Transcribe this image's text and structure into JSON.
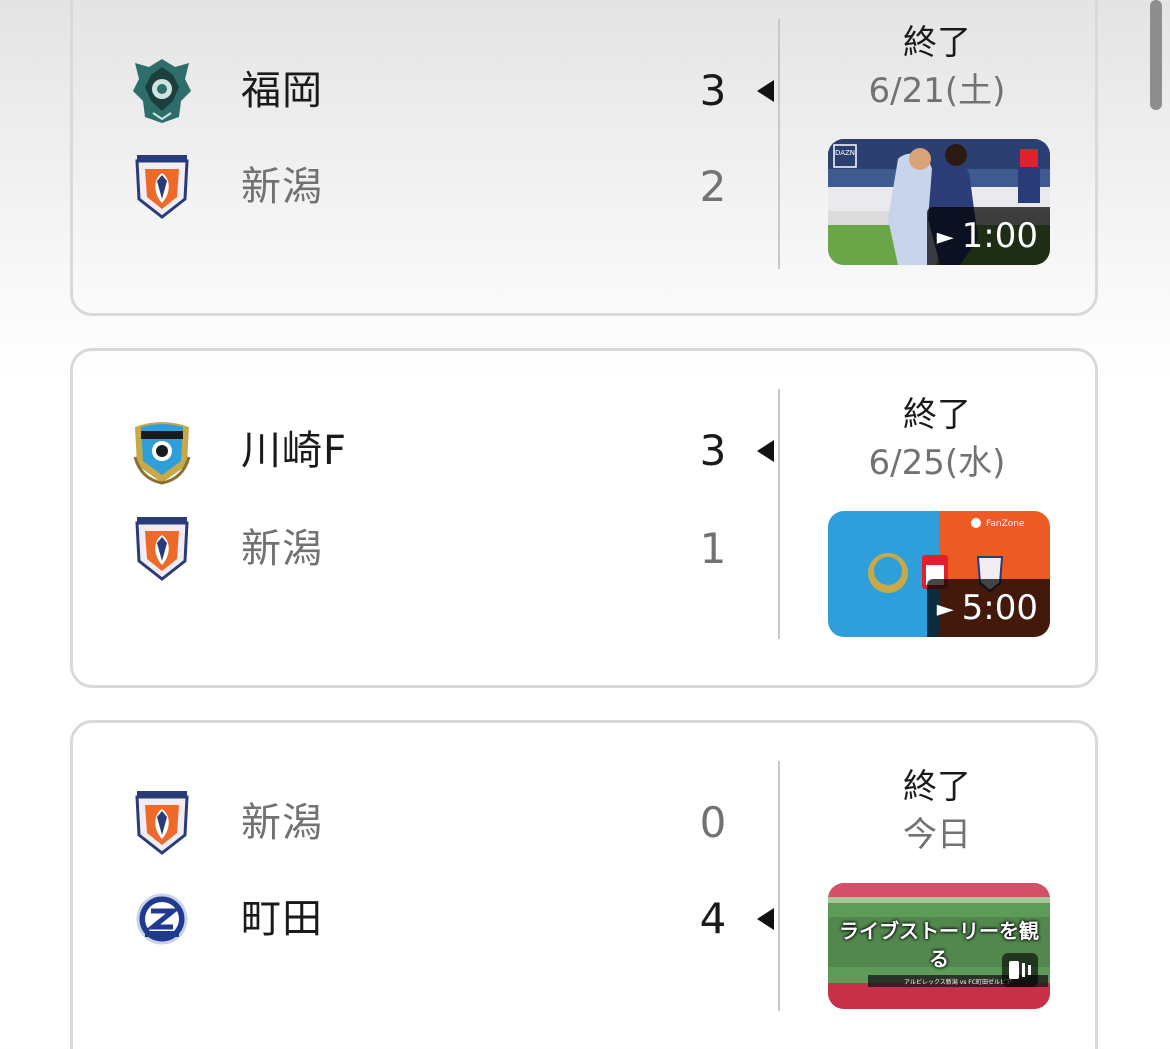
{
  "matches": [
    {
      "team1": {
        "name": "福岡",
        "score": "3",
        "crest": "avispa-fukuoka-crest-icon"
      },
      "team2": {
        "name": "新潟",
        "score": "2",
        "crest": "albirex-niigata-crest-icon"
      },
      "winner": "team1",
      "status": "終了",
      "date": "6/21(土)",
      "video": {
        "duration": "1:00",
        "type": "match-highlight-photo",
        "overlay": "DAZN"
      }
    },
    {
      "team1": {
        "name": "川崎F",
        "score": "3",
        "crest": "kawasaki-frontale-crest-icon"
      },
      "team2": {
        "name": "新潟",
        "score": "1",
        "crest": "albirex-niigata-crest-icon"
      },
      "winner": "team1",
      "status": "終了",
      "date": "6/25(水)",
      "video": {
        "duration": "5:00",
        "type": "fanzone-graphic",
        "overlay": "FanZone"
      }
    },
    {
      "team1": {
        "name": "新潟",
        "score": "0",
        "crest": "albirex-niigata-crest-icon"
      },
      "team2": {
        "name": "町田",
        "score": "4",
        "crest": "machida-zelvia-crest-icon"
      },
      "winner": "team2",
      "status": "終了",
      "date": "今日",
      "video": {
        "caption": "ライブストーリーを観る",
        "type": "live-story",
        "ticker": "アルビレックス新潟 vs FC町田ゼルビア"
      }
    }
  ],
  "colors": {
    "card_border": "#d9d9dd",
    "winner_text": "#1a1a1a",
    "loser_text": "#727272",
    "fanzone_blue": "#2f9fdc",
    "fanzone_orange": "#ee5a24"
  }
}
